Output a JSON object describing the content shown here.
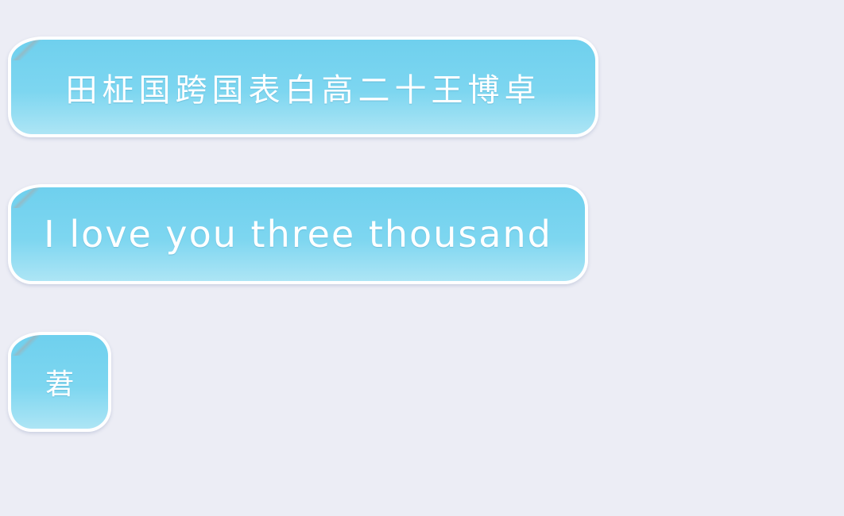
{
  "chat": {
    "messages": [
      {
        "text": "田柾国跨国表白高二十王博卓"
      },
      {
        "text": "I love you three thousand"
      },
      {
        "text": "莙"
      }
    ]
  },
  "colors": {
    "background": "#ECEDF5",
    "bubble_top": "#6FD0EE",
    "bubble_bottom": "#ADE5F5",
    "bubble_border": "#FFFFFF",
    "text": "#FFFFFF"
  }
}
